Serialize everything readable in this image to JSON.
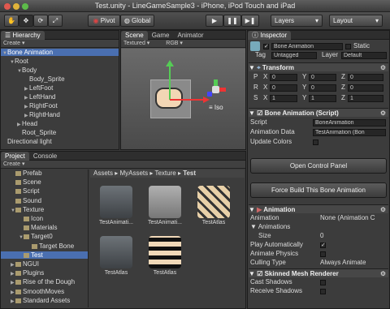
{
  "window": {
    "title": "Test.unity - LineGameSample3 - iPhone, iPod Touch and iPad"
  },
  "toolbar": {
    "pivot": "Pivot",
    "global": "Global",
    "layers": "Layers",
    "layout": "Layout"
  },
  "hierarchy": {
    "tab": "Hierarchy",
    "create": "Create",
    "items": [
      {
        "label": "Bone Animation",
        "indent": 0,
        "arrow": "▼",
        "selected": true
      },
      {
        "label": "Root",
        "indent": 1,
        "arrow": "▼"
      },
      {
        "label": "Body",
        "indent": 2,
        "arrow": "▼"
      },
      {
        "label": "Body_Sprite",
        "indent": 3,
        "arrow": ""
      },
      {
        "label": "LeftFoot",
        "indent": 3,
        "arrow": "▶"
      },
      {
        "label": "LeftHand",
        "indent": 3,
        "arrow": "▶"
      },
      {
        "label": "RightFoot",
        "indent": 3,
        "arrow": "▶"
      },
      {
        "label": "RightHand",
        "indent": 3,
        "arrow": "▶"
      },
      {
        "label": "Head",
        "indent": 2,
        "arrow": "▶"
      },
      {
        "label": "Root_Sprite",
        "indent": 2,
        "arrow": ""
      },
      {
        "label": "Directional light",
        "indent": 0,
        "arrow": ""
      }
    ]
  },
  "scene": {
    "tab_scene": "Scene",
    "tab_game": "Game",
    "tab_animator": "Animator",
    "mode": "Textured",
    "color": "RGB",
    "gizmo_label": "Iso"
  },
  "project": {
    "tab_project": "Project",
    "tab_console": "Console",
    "create": "Create",
    "tree": [
      {
        "label": "Prefab",
        "indent": 1,
        "arrow": ""
      },
      {
        "label": "Scene",
        "indent": 1,
        "arrow": ""
      },
      {
        "label": "Script",
        "indent": 1,
        "arrow": ""
      },
      {
        "label": "Sound",
        "indent": 1,
        "arrow": ""
      },
      {
        "label": "Texture",
        "indent": 1,
        "arrow": "▼"
      },
      {
        "label": "Icon",
        "indent": 2,
        "arrow": ""
      },
      {
        "label": "Materials",
        "indent": 2,
        "arrow": ""
      },
      {
        "label": "Target0",
        "indent": 2,
        "arrow": "▼"
      },
      {
        "label": "Target Bone",
        "indent": 3,
        "arrow": ""
      },
      {
        "label": "Test",
        "indent": 2,
        "arrow": "",
        "selected": true
      },
      {
        "label": "NGUI",
        "indent": 0,
        "arrow": "▶"
      },
      {
        "label": "Plugins",
        "indent": 0,
        "arrow": "▶"
      },
      {
        "label": "Rise of the Dough",
        "indent": 0,
        "arrow": "▶"
      },
      {
        "label": "SmoothMoves",
        "indent": 0,
        "arrow": "▶"
      },
      {
        "label": "Standard Assets",
        "indent": 0,
        "arrow": "▶"
      }
    ],
    "breadcrumb": [
      "Assets",
      "MyAssets",
      "Texture",
      "Test"
    ],
    "assets": [
      {
        "label": "TestAnimati...",
        "kind": "unity"
      },
      {
        "label": "TestAnimati...",
        "kind": "folder"
      },
      {
        "label": "TestAtlas",
        "kind": "atlas"
      },
      {
        "label": "TestAtlas",
        "kind": "unity"
      },
      {
        "label": "TestAtlas",
        "kind": "pigs"
      }
    ]
  },
  "inspector": {
    "tab": "Inspector",
    "object_name": "Bone Animation",
    "static_label": "Static",
    "tag_label": "Tag",
    "tag_value": "Untagged",
    "layer_label": "Layer",
    "layer_value": "Default",
    "transform": {
      "title": "Transform",
      "rows": [
        {
          "label": "P",
          "x": "0",
          "y": "0",
          "z": "0"
        },
        {
          "label": "R",
          "x": "0",
          "y": "0",
          "z": "0"
        },
        {
          "label": "S",
          "x": "1",
          "y": "1",
          "z": "1"
        }
      ],
      "axis_x": "X",
      "axis_y": "Y",
      "axis_z": "Z"
    },
    "bone_script": {
      "title": "Bone Animation (Script)",
      "script_label": "Script",
      "script_value": "BoneAnimation",
      "data_label": "Animation Data",
      "data_value": "TestAnimation (Bon",
      "update_label": "Update Colors"
    },
    "open_btn": "Open Control Panel",
    "force_btn": "Force Build This Bone Animation",
    "animation": {
      "title": "Animation",
      "anim_label": "Animation",
      "anim_value": "None (Animation C",
      "anims_label": "Animations",
      "size_label": "Size",
      "size_value": "0",
      "play_label": "Play Automatically",
      "physics_label": "Animate Physics",
      "culling_label": "Culling Type",
      "culling_value": "Always Animate"
    },
    "skinned": {
      "title": "Skinned Mesh Renderer",
      "cast_label": "Cast Shadows",
      "receive_label": "Receive Shadows"
    }
  }
}
